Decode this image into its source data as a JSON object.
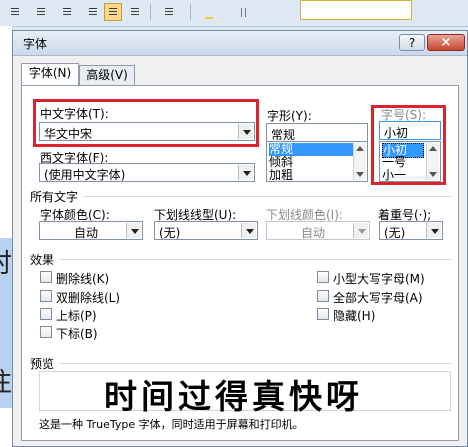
{
  "bg_text": [
    "时",
    "，",
    "往"
  ],
  "dialog": {
    "title": "字体",
    "help": "?",
    "close": "×"
  },
  "tabs": [
    "字体(N)",
    "高级(V)"
  ],
  "cn_font": {
    "label": "中文字体(T):",
    "value": "华文中宋"
  },
  "west_font": {
    "label": "西文字体(F):",
    "value": "(使用中文字体)"
  },
  "style": {
    "label": "字形(Y):",
    "value": "常规",
    "options": [
      "常规",
      "倾斜",
      "加粗"
    ],
    "selected": "常规"
  },
  "size": {
    "label": "字号(S):",
    "value": "小初",
    "options": [
      "小初",
      "一号",
      "小一"
    ],
    "selected": "小初"
  },
  "all_text": {
    "heading": "所有文字",
    "font_color": {
      "label": "字体颜色(C):",
      "value": "自动"
    },
    "underline_type": {
      "label": "下划线线型(U):",
      "value": "(无)"
    },
    "underline_color": {
      "label": "下划线颜色(I):",
      "value": "自动"
    },
    "emphasis": {
      "label": "着重号(·);",
      "value": "(无)"
    }
  },
  "effects": {
    "heading": "效果",
    "left": [
      "删除线(K)",
      "双删除线(L)",
      "上标(P)",
      "下标(B)"
    ],
    "right": [
      "小型大写字母(M)",
      "全部大写字母(A)",
      "隐藏(H)"
    ]
  },
  "preview": {
    "heading": "预览",
    "sample": "时间过得真快呀",
    "note": "这是一种 TrueType 字体，同时适用于屏幕和打印机。"
  }
}
